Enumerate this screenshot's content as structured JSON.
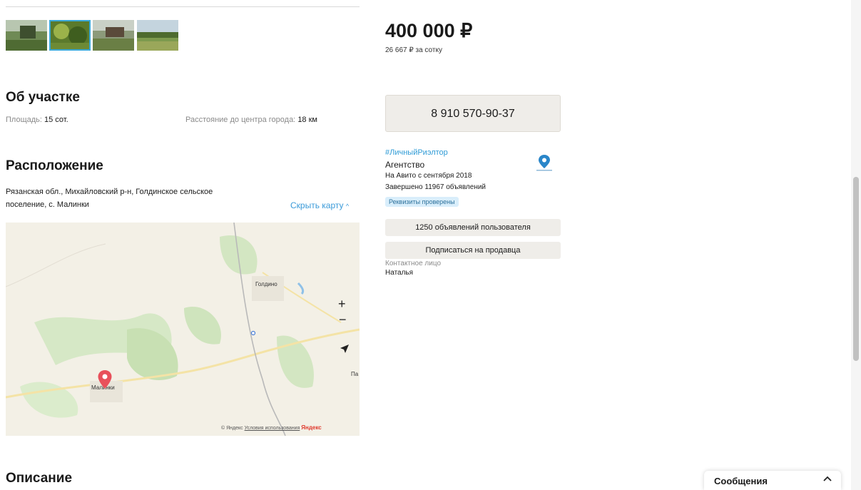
{
  "price": {
    "value": "400 000 ₽",
    "per_unit": "26 667 ₽ за сотку"
  },
  "about": {
    "title": "Об участке",
    "area_label": "Площадь:",
    "area_value": "15 сот.",
    "distance_label": "Расстояние до центра города:",
    "distance_value": "18 км"
  },
  "location": {
    "title": "Расположение",
    "address_line1": "Рязанская обл., Михайловский р-н, Голдинское сельское",
    "address_line2": "поселение, с. Малинки",
    "hide_map": "Скрыть карту",
    "hide_map_icon": "chevron-up-icon"
  },
  "map": {
    "place_main": "Малинки",
    "place_north": "Голдино",
    "place_east": "Па",
    "zoom_in": "+",
    "zoom_out": "−",
    "copyright": "© Яндекс",
    "terms": "Условия использования",
    "brand": "Яндекс",
    "locate_icon": "navigate-arrow-icon",
    "pin_icon": "map-pin-icon",
    "pin_color": "#e8505b"
  },
  "seller": {
    "phone": "8 910 570-90-37",
    "name": "#ЛичныйРиэлтор",
    "type": "Агентство",
    "since": "На Авито с сентября 2018",
    "completed": "Завершено 11967 объявлений",
    "verified": "Реквизиты проверены",
    "ads_button": "1250 объявлений пользователя",
    "subscribe_button": "Подписаться на продавца",
    "contact_label": "Контактное лицо",
    "contact_name": "Наталья",
    "logo_icon": "realtor-pin-logo-icon"
  },
  "description": {
    "title": "Описание"
  },
  "messages": {
    "label": "Сообщения",
    "toggle_icon": "chevron-up-icon"
  }
}
